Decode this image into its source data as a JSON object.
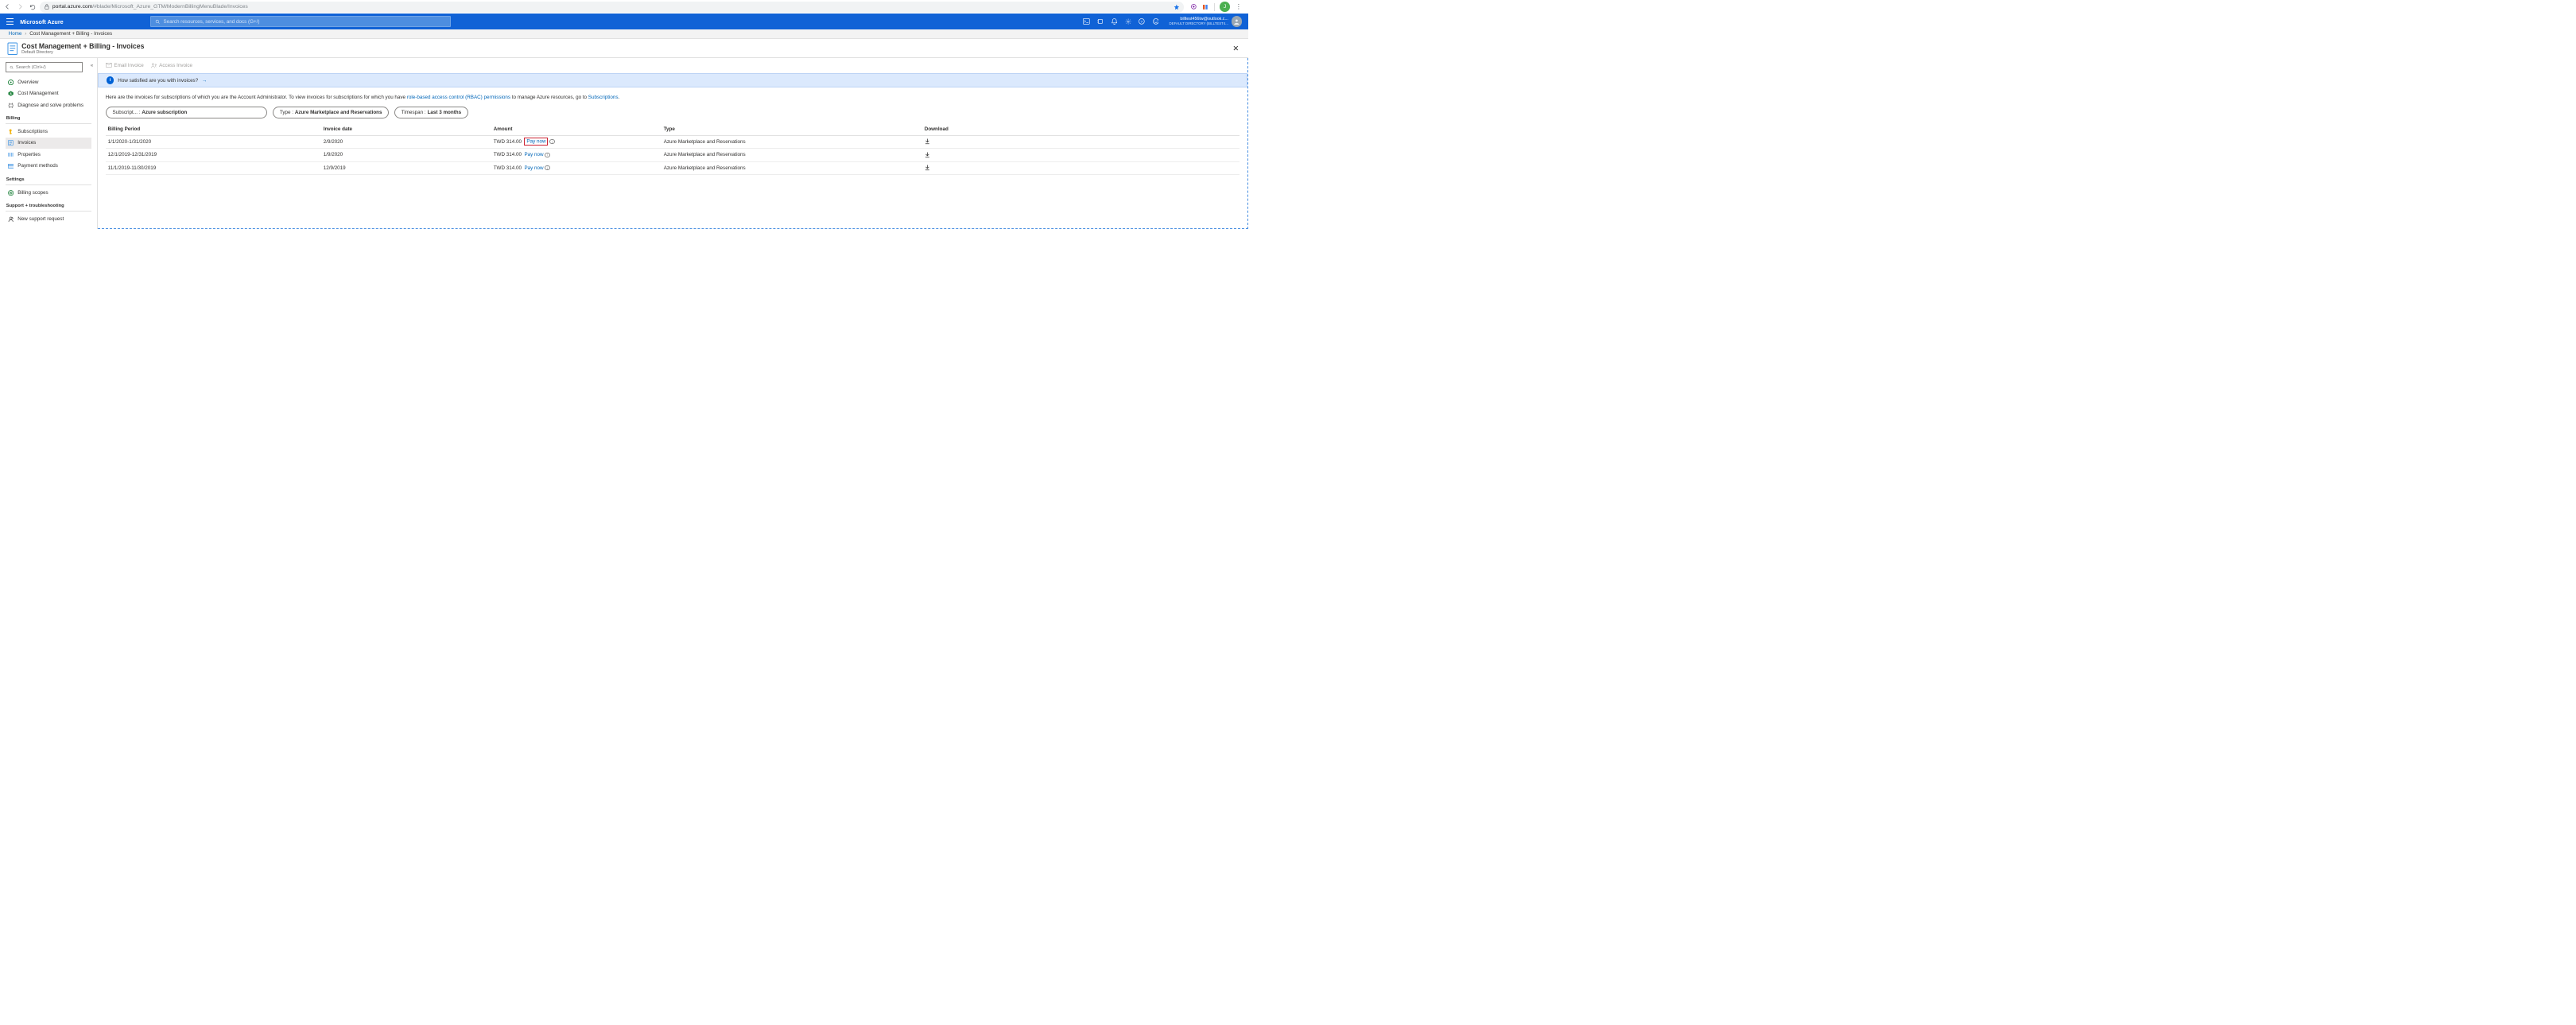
{
  "browser": {
    "url_host": "portal.azure.com",
    "url_path": "/#blade/Microsoft_Azure_GTM/ModernBillingMenuBlade/Invoices",
    "avatar_initial": "J"
  },
  "azure": {
    "brand": "Microsoft Azure",
    "search_placeholder": "Search resources, services, and docs (G+/)",
    "user_email": "billtest456tw@outlook.c...",
    "user_dir": "DEFAULT DIRECTORY (BILLTEST4..."
  },
  "breadcrumb": {
    "home": "Home",
    "current": "Cost Management + Billing - Invoices"
  },
  "blade": {
    "title": "Cost Management + Billing - Invoices",
    "subtitle": "Default Directory"
  },
  "sidebar": {
    "search_placeholder": "Search (Ctrl+/)",
    "items_top": [
      {
        "icon": "overview",
        "label": "Overview"
      },
      {
        "icon": "cost",
        "label": "Cost Management"
      },
      {
        "icon": "diagnose",
        "label": "Diagnose and solve problems"
      }
    ],
    "billing_head": "Billing",
    "items_billing": [
      {
        "icon": "key",
        "label": "Subscriptions"
      },
      {
        "icon": "invoice",
        "label": "Invoices"
      },
      {
        "icon": "props",
        "label": "Properties"
      },
      {
        "icon": "card",
        "label": "Payment methods"
      }
    ],
    "settings_head": "Settings",
    "items_settings": [
      {
        "icon": "target",
        "label": "Billing scopes"
      }
    ],
    "support_head": "Support + troubleshooting",
    "items_support": [
      {
        "icon": "support",
        "label": "New support request"
      }
    ]
  },
  "toolbar": {
    "email": "Email Invoice",
    "access": "Access Invoice"
  },
  "banner": {
    "text": "How satisfied are you with invoices?"
  },
  "intro": {
    "pre": "Here are the invoices for subscriptions of which you are the Account Administrator. To view invoices for subscriptions for which you have ",
    "link1": "role-based access control (RBAC) permissions",
    "mid": " to manage Azure resources, go to ",
    "link2": "Subscriptions",
    "post": "."
  },
  "filters": {
    "f1_label": "Subscript... : ",
    "f1_value": "Azure subscription",
    "f2_label": "Type : ",
    "f2_value": "Azure Marketplace and Reservations",
    "f3_label": "Timespan : ",
    "f3_value": "Last 3 months"
  },
  "table": {
    "headers": {
      "period": "Billing Period",
      "date": "Invoice date",
      "amount": "Amount",
      "type": "Type",
      "download": "Download"
    },
    "rows": [
      {
        "period": "1/1/2020-1/31/2020",
        "date": "2/9/2020",
        "amount": "TWD 314.00",
        "pay": "Pay now",
        "type": "Azure Marketplace and Reservations",
        "highlight": true
      },
      {
        "period": "12/1/2019-12/31/2019",
        "date": "1/9/2020",
        "amount": "TWD 314.00",
        "pay": "Pay now",
        "type": "Azure Marketplace and Reservations",
        "highlight": false
      },
      {
        "period": "11/1/2019-11/30/2019",
        "date": "12/9/2019",
        "amount": "TWD 314.00",
        "pay": "Pay now",
        "type": "Azure Marketplace and Reservations",
        "highlight": false
      }
    ]
  }
}
